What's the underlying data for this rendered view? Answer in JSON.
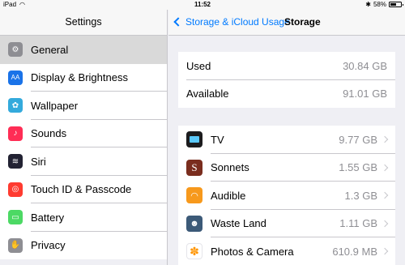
{
  "status_bar": {
    "device": "iPad",
    "time": "11:52",
    "battery": "58%"
  },
  "left": {
    "title": "Settings",
    "items": [
      {
        "label": "General",
        "icon": "gear-icon",
        "color": "#8e8e93",
        "glyph": "⚙"
      },
      {
        "label": "Display & Brightness",
        "icon": "text-size-icon",
        "color": "#1a73e8",
        "glyph": "AA"
      },
      {
        "label": "Wallpaper",
        "icon": "wallpaper-icon",
        "color": "#34aadc",
        "glyph": "✿"
      },
      {
        "label": "Sounds",
        "icon": "speaker-icon",
        "color": "#ff2d55",
        "glyph": "♪"
      },
      {
        "label": "Siri",
        "icon": "siri-icon",
        "color": "#222233",
        "glyph": "≋"
      },
      {
        "label": "Touch ID & Passcode",
        "icon": "fingerprint-icon",
        "color": "#ff3b30",
        "glyph": "◎"
      },
      {
        "label": "Battery",
        "icon": "battery-icon",
        "color": "#4cd964",
        "glyph": "▭"
      },
      {
        "label": "Privacy",
        "icon": "hand-icon",
        "color": "#8e8e93",
        "glyph": "✋"
      }
    ]
  },
  "right": {
    "back_label": "Storage & iCloud Usage",
    "title": "Storage",
    "summary": [
      {
        "label": "Used",
        "value": "30.84 GB"
      },
      {
        "label": "Available",
        "value": "91.01 GB"
      }
    ],
    "apps": [
      {
        "label": "TV",
        "value": "9.77 GB",
        "icon": "tv-app-icon",
        "color": "#1c1c1e",
        "glyph": "▬"
      },
      {
        "label": "Sonnets",
        "value": "1.55 GB",
        "icon": "sonnets-app-icon",
        "color": "#7a2d1e",
        "glyph": "S"
      },
      {
        "label": "Audible",
        "value": "1.3 GB",
        "icon": "audible-app-icon",
        "color": "#f7991c",
        "glyph": "◠"
      },
      {
        "label": "Waste Land",
        "value": "1.11 GB",
        "icon": "waste-land-app-icon",
        "color": "#3c5a78",
        "glyph": "☻"
      },
      {
        "label": "Photos & Camera",
        "value": "610.9 MB",
        "icon": "photos-app-icon",
        "color": "#ffffff",
        "glyph": "✽"
      }
    ]
  }
}
